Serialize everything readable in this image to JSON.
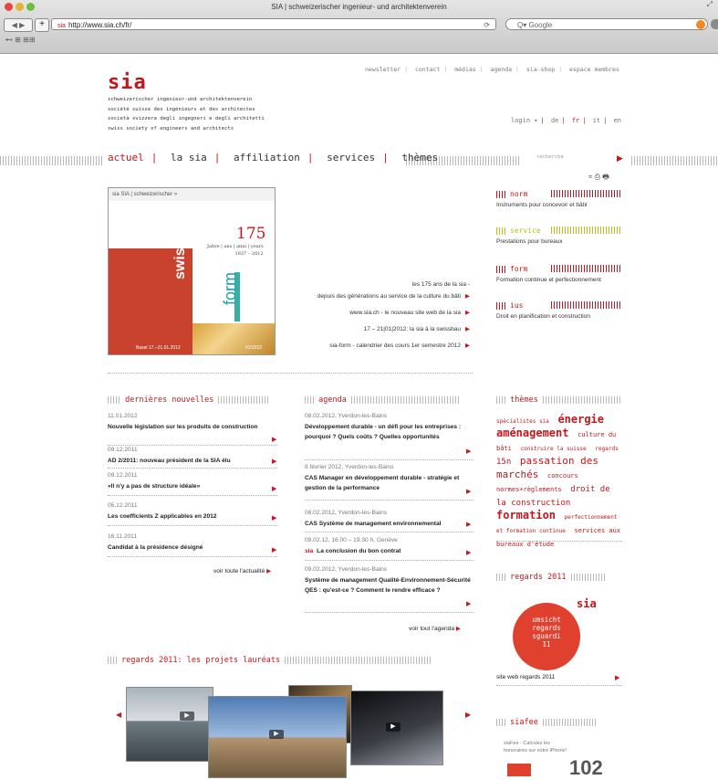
{
  "browser": {
    "title": "SIA | schweizerischer ingenieur- und architektenverein",
    "url": "http://www.sia.ch/fr/",
    "favicon_text": "sia",
    "search_placeholder": "Q▾ Google",
    "back_label": "◀ ▶",
    "add_label": "+",
    "reload_label": "⟳",
    "bookmarks_label": "⊷ ⊞ ⊞⊞"
  },
  "header": {
    "logo": "sia",
    "taglines": [
      "schweizerischer ingenieur-und architektenverein",
      "société suisse des ingénieurs et des architectes",
      "società svizzera degli ingegneri e degli architetti",
      "swiss society of engineers and architects"
    ],
    "topnav": [
      "newsletter",
      "contact",
      "médias",
      "agenda",
      "sia-shop",
      "espace membres"
    ],
    "login": "login ▾",
    "languages": [
      "de",
      "fr",
      "it",
      "en"
    ]
  },
  "mainnav": {
    "items": [
      "actuel",
      "la sia",
      "affiliation",
      "services",
      "thèmes"
    ],
    "search_placeholder": "recherche",
    "tools": "≈ ⎙ 🖶"
  },
  "hero": {
    "image_header": "sia SIA | schweizerischer »",
    "year": "175",
    "year_sub": "Jahre | ans | anni | years\n1837 – 2012",
    "brand1": "swissbau",
    "brand2": "form",
    "foot_left": "Basel 17.–21.01.2012",
    "foot_right": "01/2012",
    "links": [
      {
        "l1": "les 175 ans de la sia -",
        "l2": "depuis des générations au service de la culture du bâti"
      },
      {
        "l1": "www.sia.ch - le nouveau site web de la sia"
      },
      {
        "l1": "17 – 21|01|2012: la sia à la swissbau"
      },
      {
        "l1": "sia-form - calendrier des cours 1er semestre 2012"
      }
    ]
  },
  "right_cats": [
    {
      "label": "norm",
      "sub": "Instruments pour concevoir et bâtir",
      "color": "#c4161c"
    },
    {
      "label": "service",
      "sub": "Prestations pour bureaux",
      "color": "#b9c018"
    },
    {
      "label": "form",
      "sub": "Formation continue et perfectionnement",
      "color": "#c4161c"
    },
    {
      "label": "ius",
      "sub": "Droit en planification et construction",
      "color": "#c4161c"
    }
  ],
  "news": {
    "heading": "dernières nouvelles",
    "items": [
      {
        "date": "11.01.2012",
        "title": "Nouvelle législation sur les produits de construction"
      },
      {
        "date": "09.12.2011",
        "title": "AD 2/2011: nouveau président de la SIA élu"
      },
      {
        "date": "09.12.2011",
        "title": "«Il n'y a pas de structure idéale»"
      },
      {
        "date": "05.12.2011",
        "title": "Les coefficients Z applicables en 2012"
      },
      {
        "date": "16.11.2011",
        "title": "Candidat à la présidence désigné"
      }
    ],
    "more": "voir toute l'actualité"
  },
  "agenda": {
    "heading": "agenda",
    "items": [
      {
        "date": "08.02.2012, Yverdon-les-Bains",
        "title": "Développement durable - un défi pour les entreprises : pourquoi ? Quels coûts ? Quelles opportunités"
      },
      {
        "date": "8 février 2012, Yverdon-les-Bains",
        "title": "CAS Manager en développement durable - stratégie et gestion de la performance"
      },
      {
        "date": "08.02.2012, Yverdon-les-Bains",
        "title": "CAS Système de management environnemental"
      },
      {
        "date": "09.02.12, 16.00 – 19.30 h, Genève",
        "title": "La conclusion du bon contrat",
        "tag": "sia"
      },
      {
        "date": "09.02.2012, Yverdon-les-Bains",
        "title": "Système de management Qualité-Environnement-Sécurité QES : qu'est-ce ? Comment le rendre efficace ?"
      }
    ],
    "more": "voir tout l'agenda"
  },
  "themes": {
    "heading": "thèmes",
    "cloud": [
      {
        "t": "spécialistes sia",
        "s": 6
      },
      {
        "t": "énergie",
        "s": 12
      },
      {
        "t": "aménagement",
        "s": 12
      },
      {
        "t": "culture du bâti",
        "s": 7
      },
      {
        "t": "construire la suisse",
        "s": 6
      },
      {
        "t": "regards",
        "s": 6
      },
      {
        "t": "15n",
        "s": 9
      },
      {
        "t": "passation des marchés",
        "s": 11
      },
      {
        "t": "concours",
        "s": 7
      },
      {
        "t": "normes+règlements",
        "s": 7
      },
      {
        "t": "droit de la construction",
        "s": 9
      },
      {
        "t": "formation",
        "s": 12
      },
      {
        "t": "perfectionnement et formation continue",
        "s": 6
      },
      {
        "t": "services aux bureaux d'étude",
        "s": 7
      }
    ]
  },
  "regards": {
    "heading": "regards 2011",
    "badge_sia": "sia",
    "badge_text": [
      "umsicht",
      "regards",
      "sguardi",
      "11"
    ],
    "link": "site web regards 2011"
  },
  "siafee": {
    "heading": "siafee",
    "text": "siaFee - Calculez les honoraires sur votre iPhone!",
    "number": "102"
  },
  "gallery": {
    "heading": "regards 2011: les projets lauréats"
  }
}
